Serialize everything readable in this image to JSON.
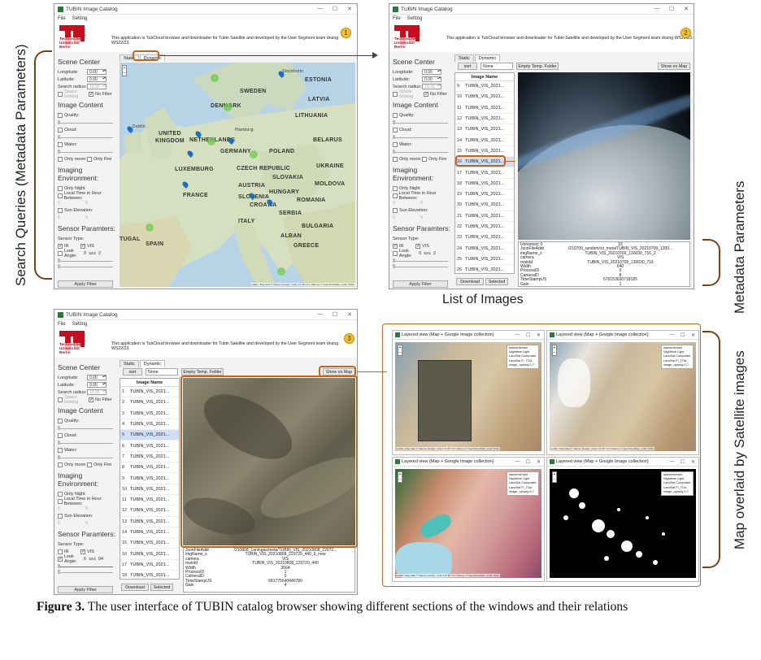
{
  "labels": {
    "search_queries": "Search Queries (Metadata Parameters)",
    "metadata_parameters": "Metadata Parameters",
    "list_of_images": "List of Images",
    "map_overlaid": "Map overlaid by Satellite images"
  },
  "caption": {
    "figure_no": "Figure 3.",
    "text": " The user interface of TUBIN catalog browser showing different sections of the windows and their relations"
  },
  "app": {
    "title": "TUBIN Image Catalog",
    "menu": [
      "File",
      "Setting"
    ],
    "description": "This application is TubCloud browser and downloader for Tubin Satellite and developed by the User Segment team druing WS22/23.",
    "logo": {
      "line1": "Technische",
      "line2": "Universität",
      "line3": "Berlin",
      "vertical": "Berlin"
    }
  },
  "panel": {
    "scene_center": "Scene Center",
    "longitude_label": "Longitude:",
    "longitude_value": "0.00",
    "latitude_label": "Latitude:",
    "latitude_value": "0.00",
    "search_radius_label": "Search radius:",
    "search_radius_value": "10.00",
    "space_looking": "Space looking",
    "no_filter": "No Filter",
    "image_content": "Image Content",
    "quality": "Quality:",
    "cloud": "Cloud:",
    "water": "Water:",
    "only_moon": "Only moon",
    "only_fire": "Only Fire",
    "imaging_env": "Imaging Environment:",
    "only_night": "Only Night",
    "local_time": "Local Time in Hour Between:",
    "sun_elevation": "Sun Elevation:",
    "sensor_params": "Sensor Paramters:",
    "sensor_type": "Sensor Type:",
    "ir": "IR",
    "vis": "VIS",
    "look_angle": "Look Angle:",
    "look_angle_a": "0",
    "look_angle_b": "2",
    "look_angle_a3": "6",
    "look_angle_b3": "84",
    "op": "≤x≤",
    "apply_filter": "Apply Filter",
    "zero": "0"
  },
  "tabs": {
    "static": "Static",
    "dynamic": "Dynamic"
  },
  "toolbar": {
    "sort": "sort",
    "none": "None",
    "empty_temp": "Empty Temp. Folder",
    "show_on_map": "Show on Map",
    "download": "Download",
    "selected": "Selected"
  },
  "list": {
    "header": "Image Name",
    "items2": [
      {
        "n": "9",
        "name": "TUBIN_VIS_2021..."
      },
      {
        "n": "10",
        "name": "TUBIN_VIS_2021..."
      },
      {
        "n": "11",
        "name": "TUBIN_VIS_2021..."
      },
      {
        "n": "12",
        "name": "TUBIN_VIS_2021..."
      },
      {
        "n": "13",
        "name": "TUBIN_VIS_2021..."
      },
      {
        "n": "14",
        "name": "TUBIN_VIS_2021..."
      },
      {
        "n": "15",
        "name": "TUBIN_VIS_2021..."
      },
      {
        "n": "16",
        "name": "TUBIN_VIS_2021..."
      },
      {
        "n": "17",
        "name": "TUBIN_VIS_2021..."
      },
      {
        "n": "18",
        "name": "TUBIN_VIS_2021..."
      },
      {
        "n": "19",
        "name": "TUBIN_VIS_2021..."
      },
      {
        "n": "20",
        "name": "TUBIN_VIS_2021..."
      },
      {
        "n": "21",
        "name": "TUBIN_VIS_2021..."
      },
      {
        "n": "22",
        "name": "TUBIN_VIS_2021..."
      },
      {
        "n": "23",
        "name": "TUBIN_VIS_2021..."
      },
      {
        "n": "24",
        "name": "TUBIN_VIS_2021..."
      },
      {
        "n": "25",
        "name": "TUBIN_VIS_2021..."
      },
      {
        "n": "26",
        "name": "TUBIN_VIS_2021..."
      }
    ],
    "items3": [
      {
        "n": "1",
        "name": "TUBIN_VIS_2021..."
      },
      {
        "n": "2",
        "name": "TUBIN_VIS_2021..."
      },
      {
        "n": "3",
        "name": "TUBIN_VIS_2021..."
      },
      {
        "n": "4",
        "name": "TUBIN_VIS_2021..."
      },
      {
        "n": "5",
        "name": "TUBIN_VIS_2021..."
      },
      {
        "n": "6",
        "name": "TUBIN_VIS_2021..."
      },
      {
        "n": "7",
        "name": "TUBIN_VIS_2021..."
      },
      {
        "n": "8",
        "name": "TUBIN_VIS_2021..."
      },
      {
        "n": "9",
        "name": "TUBIN_VIS_2021..."
      },
      {
        "n": "10",
        "name": "TUBIN_VIS_2021..."
      },
      {
        "n": "11",
        "name": "TUBIN_VIS_2021..."
      },
      {
        "n": "12",
        "name": "TUBIN_VIS_2021..."
      },
      {
        "n": "13",
        "name": "TUBIN_VIS_2021..."
      },
      {
        "n": "14",
        "name": "TUBIN_VIS_2021..."
      },
      {
        "n": "15",
        "name": "TUBIN_VIS_2021..."
      },
      {
        "n": "16",
        "name": "TUBIN_VIS_2021..."
      },
      {
        "n": "17",
        "name": "TUBIN_VIS_2021..."
      },
      {
        "n": "18",
        "name": "TUBIN_VIS_2021..."
      }
    ]
  },
  "meta2": [
    {
      "k": "Unnamed: 0",
      "v": "15"
    },
    {
      "k": "JsonFileAddr",
      "v": "/210709_random/xx_meta/TUBIN_VIS_20210709_1300..."
    },
    {
      "k": "imgName_x",
      "v": "TUBIN_VIS_20210709_130030_716_2"
    },
    {
      "k": "camera",
      "v": "VIS"
    },
    {
      "k": "mainId",
      "v": "TUBIN_VIS_20210709_130030_716"
    },
    {
      "k": "Width",
      "v": "640"
    },
    {
      "k": "ProcessID",
      "v": "0"
    },
    {
      "k": "CameraID",
      "v": "8"
    },
    {
      "k": "TimeStampUS",
      "v": "679153630718185"
    },
    {
      "k": "Gain",
      "v": "1"
    }
  ],
  "meta3": [
    {
      "k": "JsonFileAddr",
      "v": "/210808_Laningas/meta/TUBIN_VIS_20210808_22072..."
    },
    {
      "k": "imgName_x",
      "v": "TUBIN_VIS_20210808_220720_440_6_new"
    },
    {
      "k": "camera",
      "v": "VIS"
    },
    {
      "k": "mainId",
      "v": "TUBIN_VIS_20210808_220720_440"
    },
    {
      "k": "Width",
      "v": "3664"
    },
    {
      "k": "ProcessID",
      "v": "1"
    },
    {
      "k": "CameraID",
      "v": "0"
    },
    {
      "k": "TimeStampUS",
      "v": "681775640440780"
    },
    {
      "k": "Gain",
      "v": "4"
    }
  ],
  "map_labels": [
    "SWEDEN",
    "ESTONIA",
    "LATVIA",
    "DENMARK",
    "LITHUANIA",
    "UNITED",
    "KINGDOM",
    "NETHERLANDS",
    "BELARUS",
    "GERMANY",
    "POLAND",
    "LUXEMBURG",
    "CZECH REPUBLIC",
    "UKRAINE",
    "SLOVAKIA",
    "MOLDOVA",
    "FRANCE",
    "AUSTRIA",
    "HUNGARY",
    "SLOVENIA",
    "ROMANIA",
    "CROATIA",
    "ITALY",
    "SERBIA",
    "BULGARIA",
    "TUGAL",
    "SPAIN",
    "ALBAN",
    "GREECE",
    "Dublin",
    "Stockholm",
    "Hamburg"
  ],
  "layered": {
    "title": "Layered view (Map + Google Image collection)",
    "layers": [
      "stamenterrain",
      "Nighttime Light",
      "LandSat Composite",
      "LandSat FI_TOA",
      "image_opacity 0.7"
    ]
  },
  "map_attrib": "Leaflet | Map data © Stamen Design, under CC BY 3.0. Data by © OpenStreetMap, under ODbL",
  "badges": [
    "1",
    "2",
    "3"
  ],
  "colors": {
    "accent": "#c2651f",
    "tu_red": "#c50e1f",
    "badge": "#f5c02e"
  }
}
